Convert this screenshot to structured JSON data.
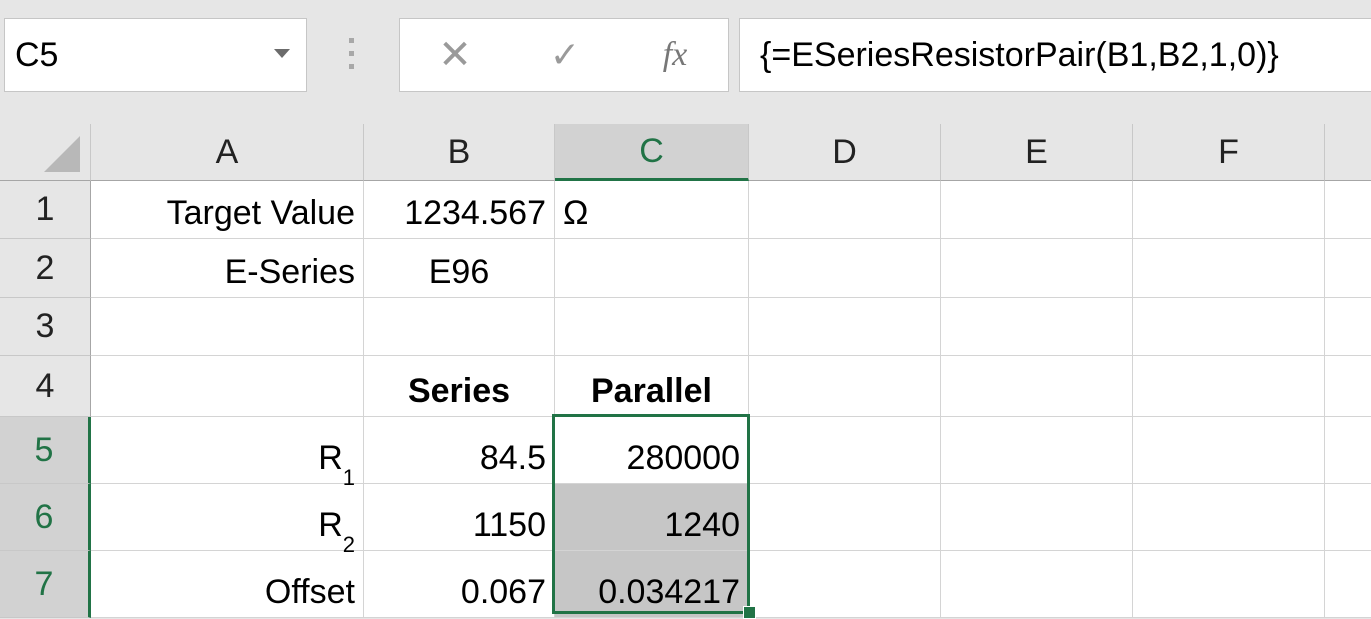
{
  "name_box": {
    "value": "C5"
  },
  "formula_bar": {
    "cancel_symbol": "✕",
    "enter_symbol": "✓",
    "fx_label": "fx",
    "formula": "{=ESeriesResistorPair(B1,B2,1,0)}"
  },
  "columns": [
    "A",
    "B",
    "C",
    "D",
    "E",
    "F"
  ],
  "rows": [
    "1",
    "2",
    "3",
    "4",
    "5",
    "6",
    "7"
  ],
  "cells": {
    "A1": "Target Value",
    "B1": "1234.567",
    "C1": "Ω",
    "A2": "E-Series",
    "B2": "E96",
    "B4": "Series",
    "C4": "Parallel",
    "A5_main": "R",
    "A5_sub": "1",
    "B5": "84.5",
    "C5": "280000",
    "A6_main": "R",
    "A6_sub": "2",
    "B6": "1150",
    "C6": "1240",
    "A7": "Offset",
    "B7": "0.067",
    "C7": "0.034217"
  },
  "colors": {
    "accent": "#217346",
    "selection_shade": "#c6c6c6"
  }
}
